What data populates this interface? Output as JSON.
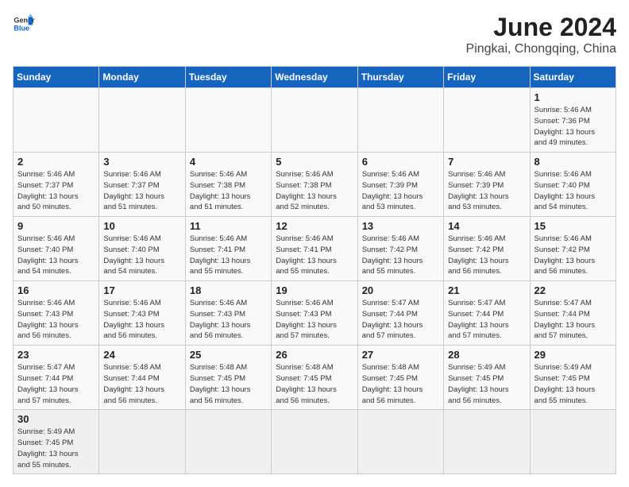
{
  "header": {
    "logo_general": "General",
    "logo_blue": "Blue",
    "title": "June 2024",
    "subtitle": "Pingkai, Chongqing, China"
  },
  "weekdays": [
    "Sunday",
    "Monday",
    "Tuesday",
    "Wednesday",
    "Thursday",
    "Friday",
    "Saturday"
  ],
  "weeks": [
    [
      null,
      null,
      null,
      null,
      null,
      null,
      {
        "day": "1",
        "sunrise": "5:46 AM",
        "sunset": "7:36 PM",
        "daylight": "13 hours and 49 minutes."
      }
    ],
    [
      {
        "day": "2",
        "sunrise": "5:46 AM",
        "sunset": "7:37 PM",
        "daylight": "13 hours and 50 minutes."
      },
      {
        "day": "3",
        "sunrise": "5:46 AM",
        "sunset": "7:37 PM",
        "daylight": "13 hours and 51 minutes."
      },
      {
        "day": "4",
        "sunrise": "5:46 AM",
        "sunset": "7:38 PM",
        "daylight": "13 hours and 51 minutes."
      },
      {
        "day": "5",
        "sunrise": "5:46 AM",
        "sunset": "7:38 PM",
        "daylight": "13 hours and 52 minutes."
      },
      {
        "day": "6",
        "sunrise": "5:46 AM",
        "sunset": "7:39 PM",
        "daylight": "13 hours and 53 minutes."
      },
      {
        "day": "7",
        "sunrise": "5:46 AM",
        "sunset": "7:39 PM",
        "daylight": "13 hours and 53 minutes."
      },
      {
        "day": "8",
        "sunrise": "5:46 AM",
        "sunset": "7:40 PM",
        "daylight": "13 hours and 54 minutes."
      }
    ],
    [
      {
        "day": "9",
        "sunrise": "5:46 AM",
        "sunset": "7:40 PM",
        "daylight": "13 hours and 54 minutes."
      },
      {
        "day": "10",
        "sunrise": "5:46 AM",
        "sunset": "7:40 PM",
        "daylight": "13 hours and 54 minutes."
      },
      {
        "day": "11",
        "sunrise": "5:46 AM",
        "sunset": "7:41 PM",
        "daylight": "13 hours and 55 minutes."
      },
      {
        "day": "12",
        "sunrise": "5:46 AM",
        "sunset": "7:41 PM",
        "daylight": "13 hours and 55 minutes."
      },
      {
        "day": "13",
        "sunrise": "5:46 AM",
        "sunset": "7:42 PM",
        "daylight": "13 hours and 55 minutes."
      },
      {
        "day": "14",
        "sunrise": "5:46 AM",
        "sunset": "7:42 PM",
        "daylight": "13 hours and 56 minutes."
      },
      {
        "day": "15",
        "sunrise": "5:46 AM",
        "sunset": "7:42 PM",
        "daylight": "13 hours and 56 minutes."
      }
    ],
    [
      {
        "day": "16",
        "sunrise": "5:46 AM",
        "sunset": "7:43 PM",
        "daylight": "13 hours and 56 minutes."
      },
      {
        "day": "17",
        "sunrise": "5:46 AM",
        "sunset": "7:43 PM",
        "daylight": "13 hours and 56 minutes."
      },
      {
        "day": "18",
        "sunrise": "5:46 AM",
        "sunset": "7:43 PM",
        "daylight": "13 hours and 56 minutes."
      },
      {
        "day": "19",
        "sunrise": "5:46 AM",
        "sunset": "7:43 PM",
        "daylight": "13 hours and 57 minutes."
      },
      {
        "day": "20",
        "sunrise": "5:47 AM",
        "sunset": "7:44 PM",
        "daylight": "13 hours and 57 minutes."
      },
      {
        "day": "21",
        "sunrise": "5:47 AM",
        "sunset": "7:44 PM",
        "daylight": "13 hours and 57 minutes."
      },
      {
        "day": "22",
        "sunrise": "5:47 AM",
        "sunset": "7:44 PM",
        "daylight": "13 hours and 57 minutes."
      }
    ],
    [
      {
        "day": "23",
        "sunrise": "5:47 AM",
        "sunset": "7:44 PM",
        "daylight": "13 hours and 57 minutes."
      },
      {
        "day": "24",
        "sunrise": "5:48 AM",
        "sunset": "7:44 PM",
        "daylight": "13 hours and 56 minutes."
      },
      {
        "day": "25",
        "sunrise": "5:48 AM",
        "sunset": "7:45 PM",
        "daylight": "13 hours and 56 minutes."
      },
      {
        "day": "26",
        "sunrise": "5:48 AM",
        "sunset": "7:45 PM",
        "daylight": "13 hours and 56 minutes."
      },
      {
        "day": "27",
        "sunrise": "5:48 AM",
        "sunset": "7:45 PM",
        "daylight": "13 hours and 56 minutes."
      },
      {
        "day": "28",
        "sunrise": "5:49 AM",
        "sunset": "7:45 PM",
        "daylight": "13 hours and 56 minutes."
      },
      {
        "day": "29",
        "sunrise": "5:49 AM",
        "sunset": "7:45 PM",
        "daylight": "13 hours and 55 minutes."
      }
    ],
    [
      {
        "day": "30",
        "sunrise": "5:49 AM",
        "sunset": "7:45 PM",
        "daylight": "13 hours and 55 minutes."
      },
      null,
      null,
      null,
      null,
      null,
      null
    ]
  ]
}
